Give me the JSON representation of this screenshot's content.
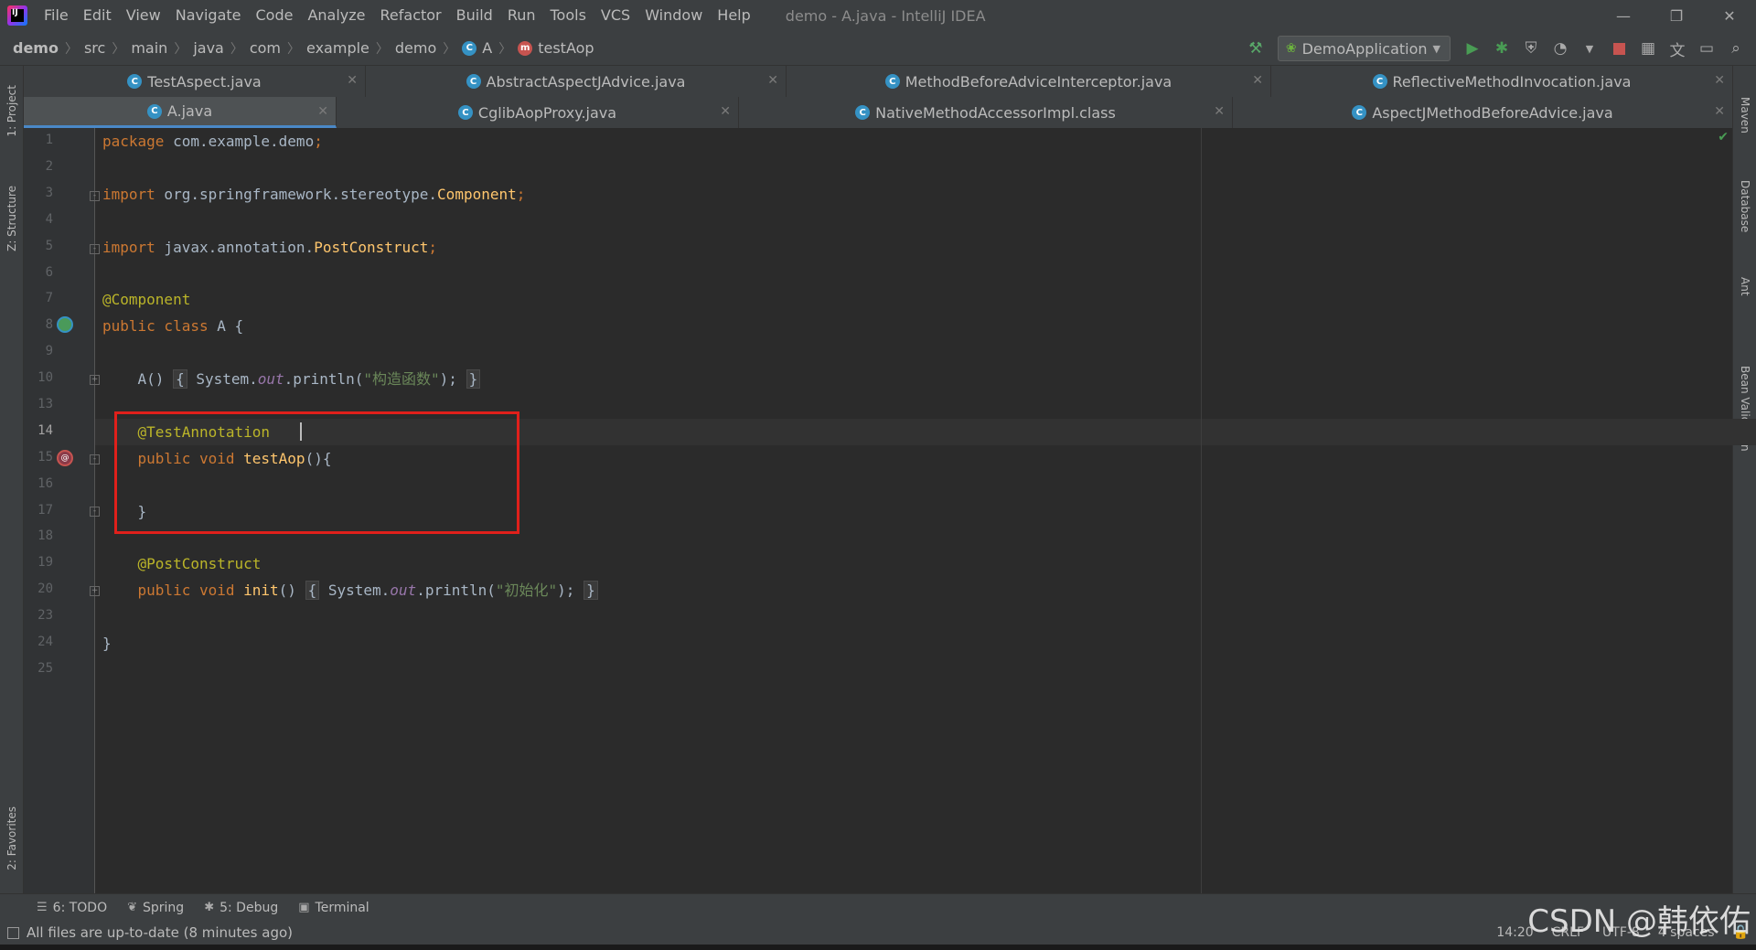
{
  "menu": [
    "File",
    "Edit",
    "View",
    "Navigate",
    "Code",
    "Analyze",
    "Refactor",
    "Build",
    "Run",
    "Tools",
    "VCS",
    "Window",
    "Help"
  ],
  "window_title": "demo - A.java - IntelliJ IDEA",
  "window_controls": {
    "minimize": "—",
    "restore": "❐",
    "close": "✕"
  },
  "breadcrumb": [
    "demo",
    "src",
    "main",
    "java",
    "com",
    "example",
    "demo",
    "A",
    "testAop"
  ],
  "run_config": "DemoApplication",
  "tabs_row1": [
    "TestAspect.java",
    "AbstractAspectJAdvice.java",
    "MethodBeforeAdviceInterceptor.java",
    "ReflectiveMethodInvocation.java"
  ],
  "tabs_row2": [
    "A.java",
    "CglibAopProxy.java",
    "NativeMethodAccessorImpl.class",
    "AspectJMethodBeforeAdvice.java"
  ],
  "active_tab": "A.java",
  "left_tools": [
    "1: Project",
    "Z: Structure",
    "2: Favorites"
  ],
  "right_tools": [
    "Maven",
    "Database",
    "Ant",
    "Bean Validation"
  ],
  "line_numbers": [
    "1",
    "2",
    "3",
    "4",
    "5",
    "6",
    "7",
    "8",
    "9",
    "10",
    "13",
    "14",
    "15",
    "16",
    "17",
    "18",
    "19",
    "20",
    "23",
    "24",
    "25"
  ],
  "current_line": "14",
  "code": {
    "l1": {
      "kw": "package",
      "rest": " com.example.demo",
      "end": ";"
    },
    "l3": {
      "kw": "import",
      "pkg": " org.springframework.stereotype.",
      "cls": "Component",
      "end": ";"
    },
    "l5": {
      "kw": "import",
      "pkg": " javax.annotation.",
      "cls": "PostConstruct",
      "end": ";"
    },
    "l7": {
      "ann": "@Component"
    },
    "l8": {
      "kw": "public class",
      "rest": " A {"
    },
    "l10": {
      "pre": "    A() ",
      "open": "{",
      "sys": " System.",
      "out": "out",
      "call": ".println(",
      "str": "\"构造函数\"",
      "close": ");",
      "brace": "}"
    },
    "l14": {
      "ann": "    @TestAnnotation"
    },
    "l15": {
      "kw": "    public void",
      "fn": " testAop",
      "rest": "(){"
    },
    "l17": {
      "rest": "    }"
    },
    "l19": {
      "ann": "    @PostConstruct"
    },
    "l20": {
      "kw": "    public void",
      "fn": " init",
      "pre": "() ",
      "open": "{",
      "sys": " System.",
      "out": "out",
      "call": ".println(",
      "str": "\"初始化\"",
      "close": ");",
      "brace": "}"
    },
    "l24": {
      "rest": "}"
    }
  },
  "tool_windows": [
    "6: TODO",
    "Spring",
    "5: Debug",
    "Terminal"
  ],
  "status_message": "All files are up-to-date (8 minutes ago)",
  "status_right": {
    "position": "14:20",
    "line_sep": "CRLF",
    "encoding": "UTF-8",
    "indent": "4 spaces"
  },
  "watermark": "CSDN @韩依佑",
  "colors": {
    "accent": "#4a88c7",
    "highlight_box": "#e0201b",
    "keyword": "#cc7832",
    "annotation": "#bbb529",
    "string": "#6a8759"
  }
}
